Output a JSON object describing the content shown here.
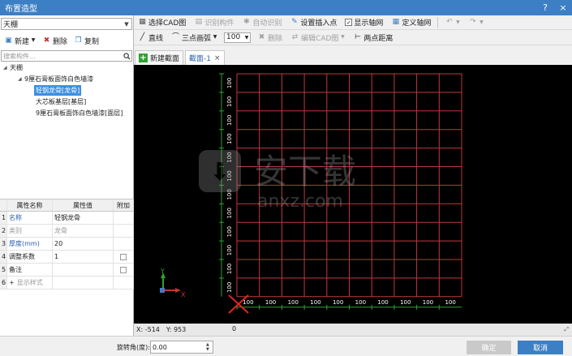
{
  "window": {
    "title": "布置造型",
    "help_icon": "?",
    "close_icon": "×"
  },
  "left": {
    "combo_value": "天棚",
    "toolbar": {
      "new_label": "新建",
      "delete_label": "删除",
      "copy_label": "复制"
    },
    "search_placeholder": "搜索构件...",
    "tree": {
      "root": "天棚",
      "child": "9厘石膏板面饰白色墙漆",
      "items": [
        "轻钢龙骨[龙骨]",
        "大芯板基层[基层]",
        "9厘石膏板面饰白色墙漆[面层]"
      ],
      "selected_index": 0
    },
    "props": {
      "headers": [
        "属性名称",
        "属性值",
        "附加"
      ],
      "rows": [
        {
          "num": "1",
          "name": "名称",
          "value": "轻钢龙骨",
          "check": false
        },
        {
          "num": "2",
          "name": "类别",
          "value": "龙骨",
          "check": false
        },
        {
          "num": "3",
          "name": "厚度(mm)",
          "value": "20",
          "check": false
        },
        {
          "num": "4",
          "name": "调整系数",
          "value": "1",
          "check": true
        },
        {
          "num": "5",
          "name": "备注",
          "value": "",
          "check": true
        },
        {
          "num": "6",
          "name": "显示样式",
          "value": "",
          "check": false
        }
      ],
      "row6_prefix": "+"
    }
  },
  "toolbar1": {
    "select_cad": "选择CAD图",
    "identify_component": "识别构件",
    "auto_identify": "自动识别",
    "set_insert_point": "设置插入点",
    "show_axis": "显示轴网",
    "define_axis": "定义轴网"
  },
  "toolbar2": {
    "line": "直线",
    "three_point_arc": "三点画弧",
    "width_value": "100",
    "delete": "删除",
    "edit_cad": "编辑CAD图",
    "two_point_distance": "两点距离"
  },
  "tabs": {
    "new_section": "新建截面",
    "section_tab": "截面-1",
    "close_icon": "×"
  },
  "canvas": {
    "grid_label": "100",
    "rows": 12,
    "cols": 10,
    "axis_y": "Y",
    "axis_x": "X",
    "line_color": "#c0393b",
    "dim_color": "#2fa22f",
    "watermark_main": "安下载",
    "watermark_sub": "anxz.com"
  },
  "status": {
    "x": "X: -514",
    "y": "Y: 953",
    "z": "0"
  },
  "bottom": {
    "rotation_label": "旋转角(度):",
    "rotation_value": "0.00",
    "ok": "确定",
    "cancel": "取消"
  }
}
